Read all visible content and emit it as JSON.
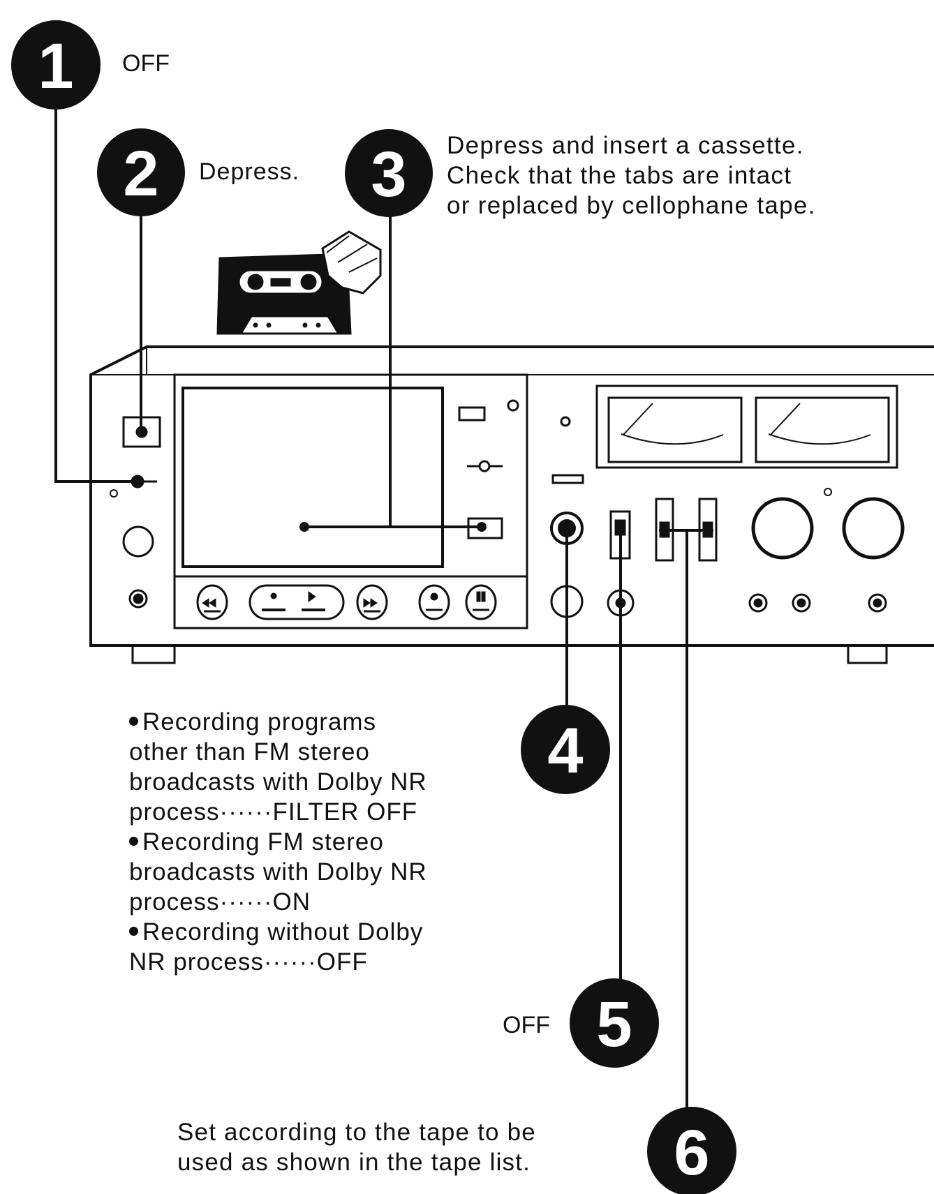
{
  "steps": [
    {
      "number": "1",
      "label": "OFF"
    },
    {
      "number": "2",
      "label": "Depress."
    },
    {
      "number": "3",
      "label_lines": [
        "Depress and insert a cassette.",
        "Check that the tabs are intact",
        "or replaced by cellophane tape."
      ]
    },
    {
      "number": "4",
      "note_items": [
        {
          "lines": [
            "Recording programs",
            "other than FM stereo",
            "broadcasts with Dolby NR",
            "process······FILTER OFF"
          ]
        },
        {
          "lines": [
            "Recording FM stereo",
            "broadcasts with Dolby NR",
            "process······ON"
          ]
        },
        {
          "lines": [
            "Recording without Dolby",
            "NR process······OFF"
          ]
        }
      ]
    },
    {
      "number": "5",
      "label": "OFF"
    },
    {
      "number": "6",
      "label_lines": [
        "Set according to the tape to be",
        "used as shown in the tape list."
      ]
    }
  ],
  "colors": {
    "ink": "#111111",
    "paper": "#ffffff"
  }
}
